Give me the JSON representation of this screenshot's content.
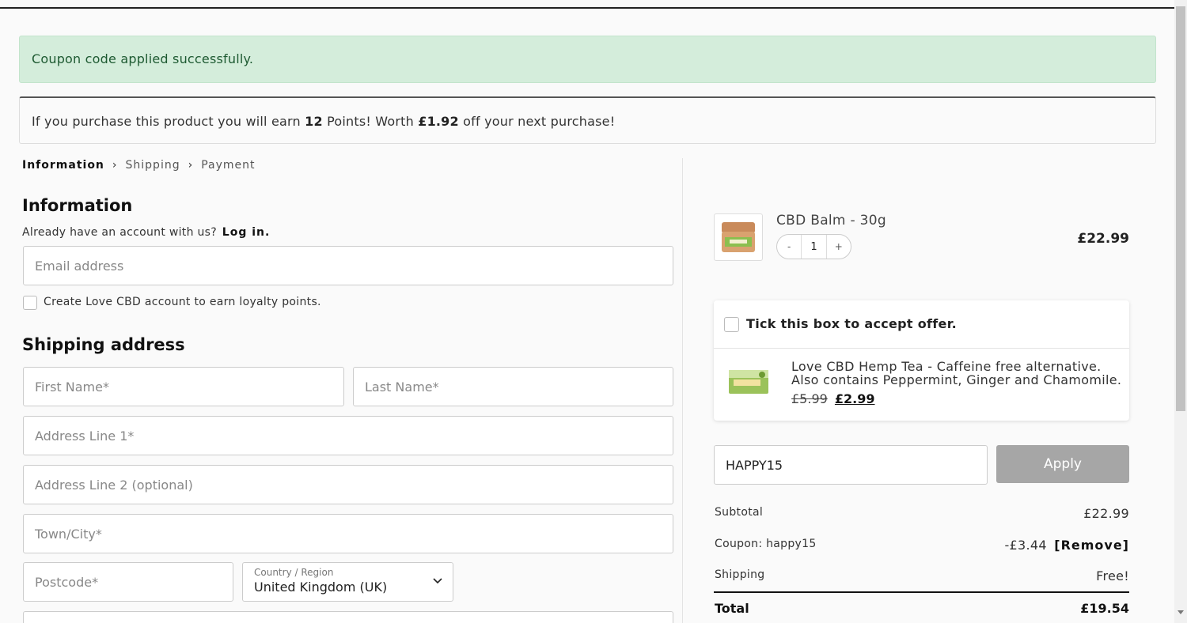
{
  "notices": {
    "success": "Coupon code applied successfully.",
    "points": {
      "prefix": "If you purchase this product you will earn",
      "points": "12",
      "middle": "Points! Worth",
      "worth": "£1.92",
      "suffix": "off your next purchase!"
    }
  },
  "breadcrumb": {
    "current": "Information",
    "step2": "Shipping",
    "step3": "Payment"
  },
  "information": {
    "title": "Information",
    "account_prompt": "Already have an account with us?",
    "login_label": "Log in.",
    "email_placeholder": "Email address",
    "create_account_label": "Create Love CBD account to earn loyalty points."
  },
  "shipping": {
    "title": "Shipping address",
    "first_name_placeholder": "First Name*",
    "last_name_placeholder": "Last Name*",
    "address1_placeholder": "Address Line 1*",
    "address2_placeholder": "Address Line 2 (optional)",
    "town_placeholder": "Town/City*",
    "postcode_placeholder": "Postcode*",
    "country_label": "Country / Region",
    "country_value": "United Kingdom (UK)"
  },
  "cart": {
    "item": {
      "name": "CBD Balm - 30g",
      "quantity": "1",
      "minus": "-",
      "plus": "+",
      "price": "£22.99"
    },
    "offer": {
      "accept_label": "Tick this box to accept offer.",
      "description": "Love CBD Hemp Tea - Caffeine free alternative. Also contains Peppermint, Ginger and Chamomile.",
      "old_price": "£5.99",
      "new_price": "£2.99"
    },
    "coupon": {
      "value": "HAPPY15",
      "apply_label": "Apply"
    },
    "summary": {
      "subtotal_label": "Subtotal",
      "subtotal_value": "£22.99",
      "coupon_label": "Coupon: happy15",
      "coupon_value": "-£3.44",
      "remove_label": "[Remove]",
      "shipping_label": "Shipping",
      "shipping_value": "Free!",
      "total_label": "Total",
      "total_value": "£19.54"
    }
  },
  "colors": {
    "success_bg": "#d4eddb",
    "success_text": "#1e5a32",
    "apply_button": "#a6a6a6"
  }
}
